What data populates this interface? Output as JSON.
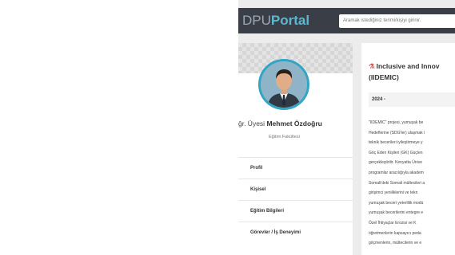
{
  "header": {
    "logo_part1": "DPU",
    "logo_part2": "Portal",
    "search_placeholder": "Aramak istediğiniz terimi/kişiyi girinir."
  },
  "profile": {
    "title_prefix": "ğr. Üyesi",
    "name": "Mehmet Özdoğru",
    "faculty": "Eğitim Fakültesi",
    "menu": [
      "Profil",
      "Kişisel",
      "Eğitim Bilgileri",
      "Görevler / İş Deneyimi"
    ]
  },
  "project": {
    "title_line1": "Inclusive and Innov",
    "title_line2": "(IIDEMIC)",
    "date": "2024 -",
    "description_lines": [
      "\"IIDEMIC\" projesi, yumuşak be",
      "Hedeflerine (SDG'ler) ulaşmak i",
      "teknik becerileri iyileştirmeye y",
      "Göç Eden Kişileri (GK) Güçlen",
      "gerçekleştirilir. Kenyatta Ünive",
      "programlar aracılığıyla akadem",
      "Somali'deki Somali mültecileri a",
      "girişimci yeniliklerini ve tekn",
      "yumuşak beceri yeterlilik modü",
      "yumuşak becerilerini entegre e",
      "Özel İhtiyaçlar Erozisi ve K",
      "öğretmenlerin kapsayıcı peda",
      "göçmenlerin, mültecilerin ve e"
    ]
  }
}
